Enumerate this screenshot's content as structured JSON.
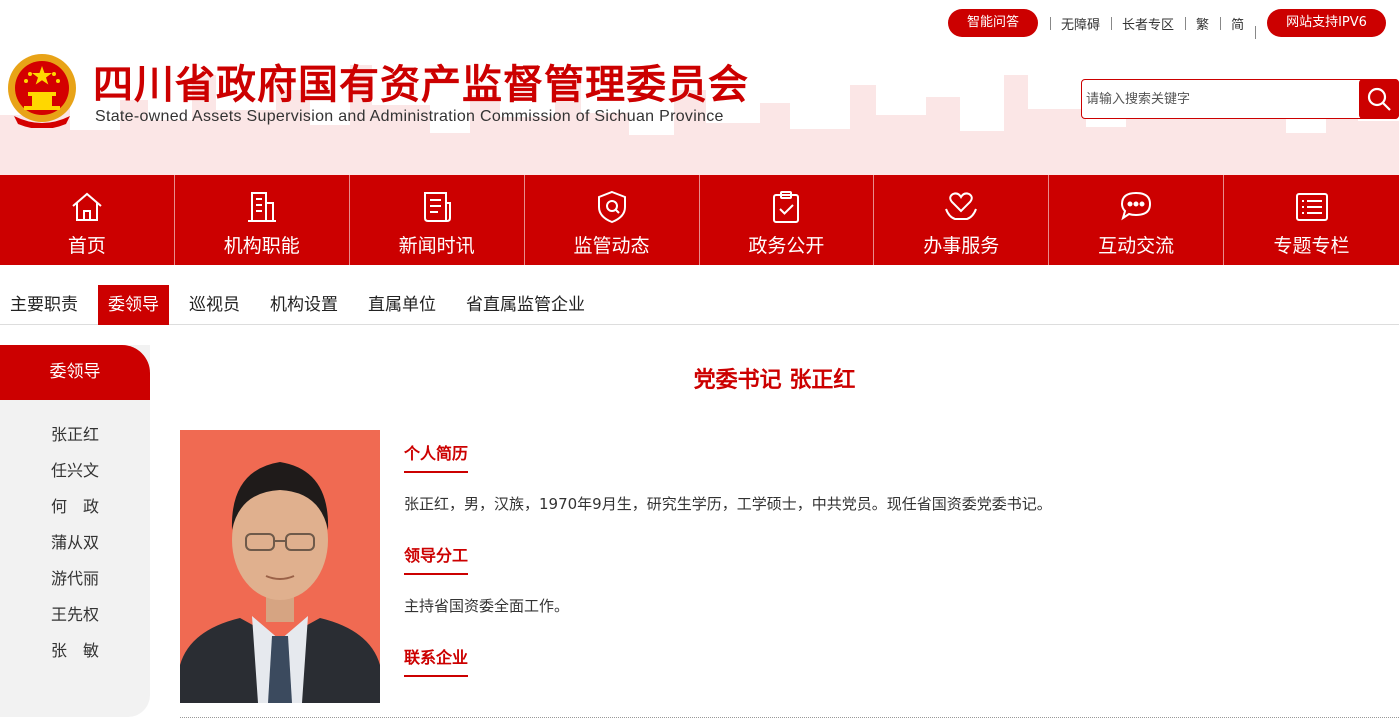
{
  "header": {
    "title": "四川省政府国有资产监督管理委员会",
    "subtitle": "State-owned Assets Supervision and Administration Commission of Sichuan Province",
    "smart_qa": "智能问答",
    "links": [
      "无障碍",
      "长者专区",
      "繁",
      "简"
    ],
    "ipv6": "网站支持IPV6",
    "search_placeholder": "请输入搜索关键字"
  },
  "nav": [
    {
      "label": "首页",
      "icon": "home-icon"
    },
    {
      "label": "机构职能",
      "icon": "building-icon"
    },
    {
      "label": "新闻时讯",
      "icon": "news-icon"
    },
    {
      "label": "监管动态",
      "icon": "shield-icon"
    },
    {
      "label": "政务公开",
      "icon": "clipboard-check-icon"
    },
    {
      "label": "办事服务",
      "icon": "heart-hand-icon"
    },
    {
      "label": "互动交流",
      "icon": "chat-icon"
    },
    {
      "label": "专题专栏",
      "icon": "list-icon"
    }
  ],
  "subnav": [
    "主要职责",
    "委领导",
    "巡视员",
    "机构设置",
    "直属单位",
    "省直属监管企业"
  ],
  "sidebar": {
    "heading": "委领导",
    "items": [
      "张正红",
      "任兴文",
      "何　政",
      "蒲从双",
      "游代丽",
      "王先权",
      "张　敏"
    ]
  },
  "main": {
    "title": "党委书记 张正红",
    "sections": [
      {
        "heading": "个人简历",
        "text": "张正红，男，汉族，1970年9月生，研究生学历，工学硕士，中共党员。现任省国资委党委书记。"
      },
      {
        "heading": "领导分工",
        "text": "主持省国资委全面工作。"
      },
      {
        "heading": "联系企业",
        "text": ""
      }
    ]
  },
  "colors": {
    "brand": "#cc0000",
    "photo_bg": "#f06a52",
    "sidebar_bg": "#f2f2f2"
  }
}
